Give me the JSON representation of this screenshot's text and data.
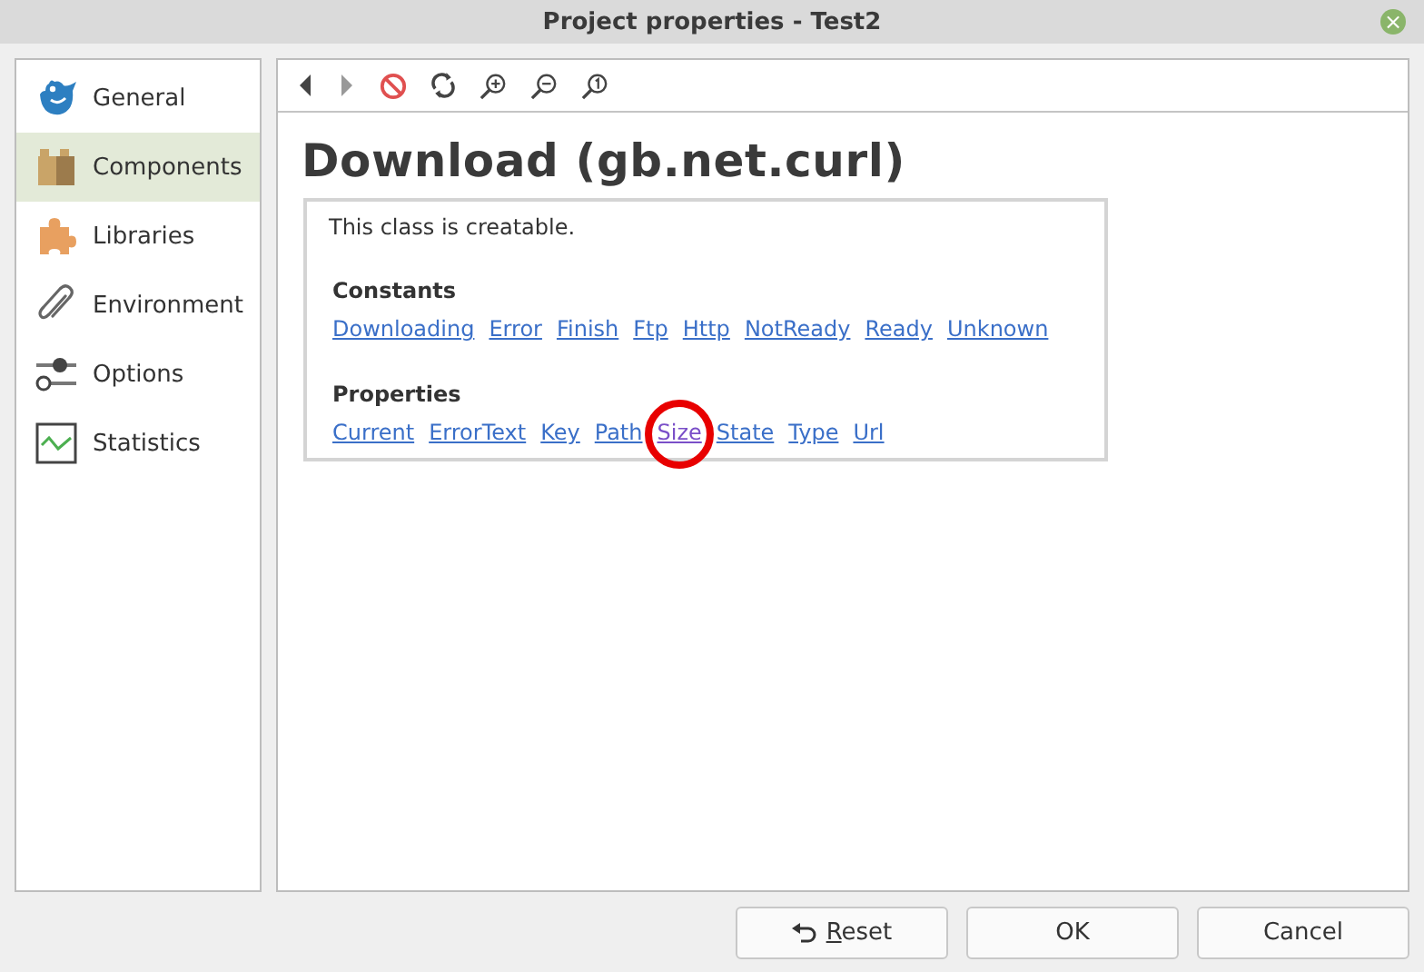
{
  "window": {
    "title": "Project properties - Test2",
    "close": "×"
  },
  "sidebar": {
    "items": [
      {
        "label": "General",
        "selected": false
      },
      {
        "label": "Components",
        "selected": true
      },
      {
        "label": "Libraries",
        "selected": false
      },
      {
        "label": "Environment",
        "selected": false
      },
      {
        "label": "Options",
        "selected": false
      },
      {
        "label": "Statistics",
        "selected": false
      }
    ]
  },
  "content": {
    "heading": "Download (gb.net.curl)",
    "note": "This class is creatable.",
    "sections": [
      {
        "title": "Constants",
        "links": [
          {
            "text": "Downloading",
            "visited": false
          },
          {
            "text": "Error",
            "visited": false
          },
          {
            "text": "Finish",
            "visited": false
          },
          {
            "text": "Ftp",
            "visited": false
          },
          {
            "text": "Http",
            "visited": false
          },
          {
            "text": "NotReady",
            "visited": false
          },
          {
            "text": "Ready",
            "visited": false
          },
          {
            "text": "Unknown",
            "visited": false
          }
        ]
      },
      {
        "title": "Properties",
        "links": [
          {
            "text": "Current",
            "visited": false
          },
          {
            "text": "ErrorText",
            "visited": false
          },
          {
            "text": "Key",
            "visited": false
          },
          {
            "text": "Path",
            "visited": false
          },
          {
            "text": "Size",
            "visited": true,
            "circled": true
          },
          {
            "text": "State",
            "visited": false
          },
          {
            "text": "Type",
            "visited": false
          },
          {
            "text": "Url",
            "visited": false
          }
        ]
      }
    ]
  },
  "buttons": [
    {
      "label": "Reset",
      "mnemonic": true,
      "kind": "reset"
    },
    {
      "label": "OK",
      "mnemonic": false,
      "kind": "plain"
    },
    {
      "label": "Cancel",
      "mnemonic": false,
      "kind": "plain"
    }
  ]
}
